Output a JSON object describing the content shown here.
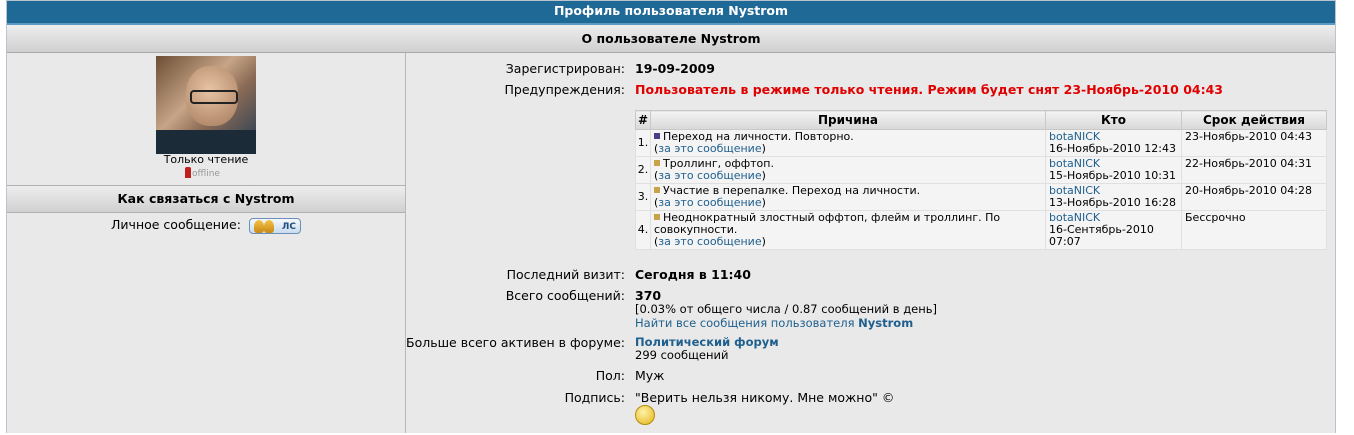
{
  "header": {
    "title": "Профиль пользователя Nystrom",
    "subtitle": "О пользователе Nystrom"
  },
  "left": {
    "rank": "Только чтение",
    "status": "offline",
    "contact_title": "Как связаться с Nystrom",
    "pm_label": "Личное сообщение:",
    "pm_button": "ЛС"
  },
  "info": {
    "registered_label": "Зарегистрирован:",
    "registered_value": "19-09-2009",
    "warnings_label": "Предупреждения:",
    "warnings_value": "Пользователь в режиме только чтения. Режим будет снят 23-Ноябрь-2010 04:43",
    "last_visit_label": "Последний визит:",
    "last_visit_value": "Сегодня в 11:40",
    "posts_label": "Всего сообщений:",
    "posts_value": "370",
    "posts_stats": "[0.03% от общего числа / 0.87 сообщений в день]",
    "find_posts_prefix": "Найти все сообщения пользователя ",
    "find_posts_user": "Nystrom",
    "active_label": "Больше всего активен в форуме:",
    "active_forum": "Политический форум",
    "active_count": "299 сообщений",
    "gender_label": "Пол:",
    "gender_value": "Муж",
    "signature_label": "Подпись:",
    "signature_value": "\"Верить нельзя никому. Мне можно\" ©"
  },
  "warnings_table": {
    "headers": [
      "#",
      "Причина",
      "Кто",
      "Срок действия"
    ],
    "link_text": "за это сообщение",
    "rows": [
      {
        "num": "1.",
        "reason": "Переход на личности. Повторно.",
        "who": "botaNICK",
        "when": "16-Ноябрь-2010 12:43",
        "expires": "23-Ноябрь-2010 04:43",
        "color": "#4b3d8c"
      },
      {
        "num": "2.",
        "reason": "Троллинг, оффтоп.",
        "who": "botaNICK",
        "when": "15-Ноябрь-2010 10:31",
        "expires": "22-Ноябрь-2010 04:31",
        "color": "#c9a24a"
      },
      {
        "num": "3.",
        "reason": "Участие в перепалке. Переход на личности.",
        "who": "botaNICK",
        "when": "13-Ноябрь-2010 16:28",
        "expires": "20-Ноябрь-2010 04:28",
        "color": "#c9a24a"
      },
      {
        "num": "4.",
        "reason": "Неоднократный злостный оффтоп, флейм и троллинг. По совокупности.",
        "who": "botaNICK",
        "when": "16-Сентябрь-2010 07:07",
        "expires": "Бессрочно",
        "color": "#c9a24a"
      }
    ]
  }
}
